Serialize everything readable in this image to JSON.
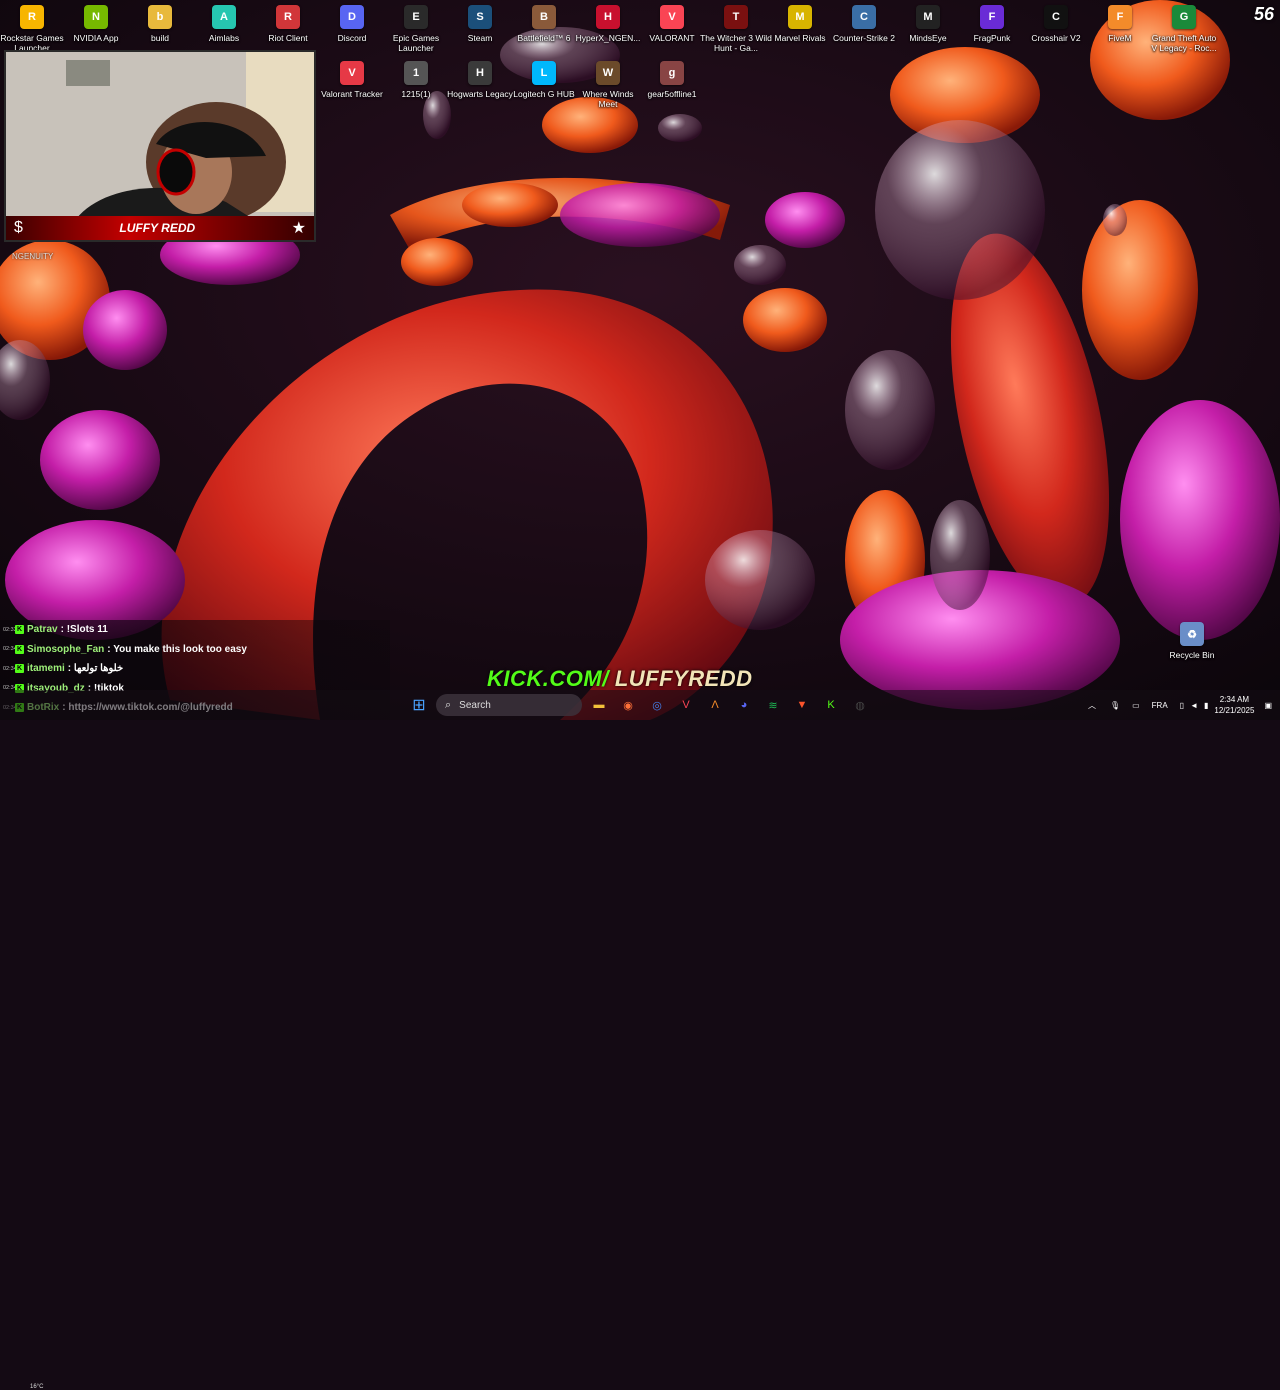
{
  "desktop": {
    "row1": [
      {
        "label": "Rockstar Games Launcher",
        "icon": "rockstar-icon",
        "color": "#f7b500"
      },
      {
        "label": "NVIDIA App",
        "icon": "nvidia-icon",
        "color": "#76b900"
      },
      {
        "label": "build",
        "icon": "folder-icon",
        "color": "#e8b93c"
      },
      {
        "label": "Aimlabs",
        "icon": "aimlabs-icon",
        "color": "#26c6b0"
      },
      {
        "label": "Riot Client",
        "icon": "riot-icon",
        "color": "#d13639"
      },
      {
        "label": "Discord",
        "icon": "discord-icon",
        "color": "#5865f2"
      },
      {
        "label": "Epic Games Launcher",
        "icon": "epic-icon",
        "color": "#2a2a2a"
      },
      {
        "label": "Steam",
        "icon": "steam-icon",
        "color": "#1b4f7a"
      },
      {
        "label": "Battlefield™ 6",
        "icon": "battlefield-icon",
        "color": "#8a5a3a"
      },
      {
        "label": "HyperX_NGEN...",
        "icon": "hyperx-icon",
        "color": "#c8102e"
      },
      {
        "label": "VALORANT",
        "icon": "valorant-icon",
        "color": "#fa4454"
      },
      {
        "label": "The Witcher 3 Wild Hunt - Ga...",
        "icon": "witcher-icon",
        "color": "#7a1010"
      },
      {
        "label": "Marvel Rivals",
        "icon": "marvel-rivals-icon",
        "color": "#d8b400"
      },
      {
        "label": "Counter-Strike 2",
        "icon": "cs2-icon",
        "color": "#3a6ea5"
      },
      {
        "label": "MindsEye",
        "icon": "mindseye-icon",
        "color": "#222"
      },
      {
        "label": "FragPunk",
        "icon": "fragpunk-icon",
        "color": "#6a2bd6"
      },
      {
        "label": "Crosshair V2",
        "icon": "crosshair-icon",
        "color": "#111"
      },
      {
        "label": "FiveM",
        "icon": "fivem-icon",
        "color": "#f38b2a"
      },
      {
        "label": "Grand Theft Auto V Legacy - Roc...",
        "icon": "gta-icon",
        "color": "#1a8a3a"
      }
    ],
    "row2": [
      {
        "label": "Valorant Tracker",
        "icon": "valorant-tracker-icon",
        "color": "#e63946"
      },
      {
        "label": "1215(1)",
        "icon": "image-file-icon",
        "color": "#555"
      },
      {
        "label": "Hogwarts Legacy",
        "icon": "hogwarts-icon",
        "color": "#3a3a3a"
      },
      {
        "label": "Logitech G HUB",
        "icon": "logitech-icon",
        "color": "#00b8fc"
      },
      {
        "label": "Where Winds Meet",
        "icon": "where-winds-meet-icon",
        "color": "#6b4a2a"
      },
      {
        "label": "gear5offline1",
        "icon": "image-file-icon",
        "color": "#884444"
      }
    ],
    "recycle_bin": "Recycle Bin",
    "ngenuity_label": "NGENUITY"
  },
  "overlay": {
    "streamer_name": "LUFFY REDD",
    "fps": "56",
    "kick_site": "KICK.COM/",
    "kick_handle": "LUFFYREDD"
  },
  "chat": [
    {
      "time": "02:33",
      "user": "Patrav",
      "msg": "!Slots 11"
    },
    {
      "time": "02:34",
      "user": "Simosophe_Fan",
      "msg": "You make this look too easy"
    },
    {
      "time": "02:34",
      "user": "itamemi",
      "msg": "خلوها تولعها"
    },
    {
      "time": "02:34",
      "user": "itsayoub_dz",
      "msg": "!tiktok"
    },
    {
      "time": "02:34",
      "user": "BotRix",
      "msg": "https://www.tiktok.com/@luffyredd"
    }
  ],
  "taskbar": {
    "search_placeholder": "Search",
    "weather": "16°C",
    "language": "FRA",
    "time": "2:34 AM",
    "date": "12/21/2025",
    "apps": [
      {
        "icon": "file-explorer-icon",
        "color": "#f3c13a",
        "glyph": "▬"
      },
      {
        "icon": "firefox-icon",
        "color": "#ff7139",
        "glyph": "◉"
      },
      {
        "icon": "chrome-icon",
        "color": "#4285f4",
        "glyph": "◎"
      },
      {
        "icon": "valorant-taskbar-icon",
        "color": "#fa4454",
        "glyph": "V"
      },
      {
        "icon": "aimlabs-taskbar-icon",
        "color": "#f38b2a",
        "glyph": "Λ"
      },
      {
        "icon": "discord-taskbar-icon",
        "color": "#5865f2",
        "glyph": "◕"
      },
      {
        "icon": "spotify-icon",
        "color": "#1db954",
        "glyph": "≋"
      },
      {
        "icon": "brave-icon",
        "color": "#fb542b",
        "glyph": "▼"
      },
      {
        "icon": "kick-app-icon",
        "color": "#53fc18",
        "glyph": "K"
      },
      {
        "icon": "obs-icon",
        "color": "#444",
        "glyph": "◍"
      }
    ]
  }
}
